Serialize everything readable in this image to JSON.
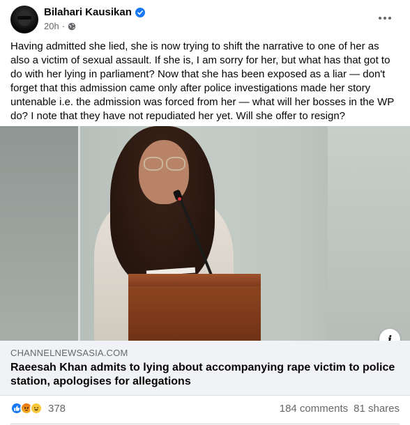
{
  "post": {
    "author": "Bilahari Kausikan",
    "timestamp": "20h",
    "separator": "·",
    "text": "Having admitted she lied, she is now trying to shift the narrative to one of her as also a victim of sexual assault. If she is, I am sorry for her, but what has that got to do with her lying in parliament? Now that she has been exposed as a liar — don't forget that this admission came only after police investigations made her story untenable i.e. the admission was forced from her — what will her bosses in the WP do? I note that they have not repudiated her yet. Will she offer to resign?"
  },
  "link_preview": {
    "domain": "CHANNELNEWSASIA.COM",
    "title": "Raeesah Khan admits to lying about accompanying rape victim to police station, apologises for allegations",
    "info_glyph": "i"
  },
  "footer": {
    "reaction_count": "378",
    "comments": "184 comments",
    "shares": "81 shares"
  },
  "icons": {
    "verified": "verified-badge-icon",
    "privacy": "globe-icon",
    "more": "more-options-icon",
    "reactions": [
      "like-icon",
      "angry-icon",
      "haha-icon"
    ]
  },
  "colors": {
    "accent": "#1877f2",
    "secondary_text": "#65676b",
    "link_box_bg": "#f0f2f5"
  }
}
